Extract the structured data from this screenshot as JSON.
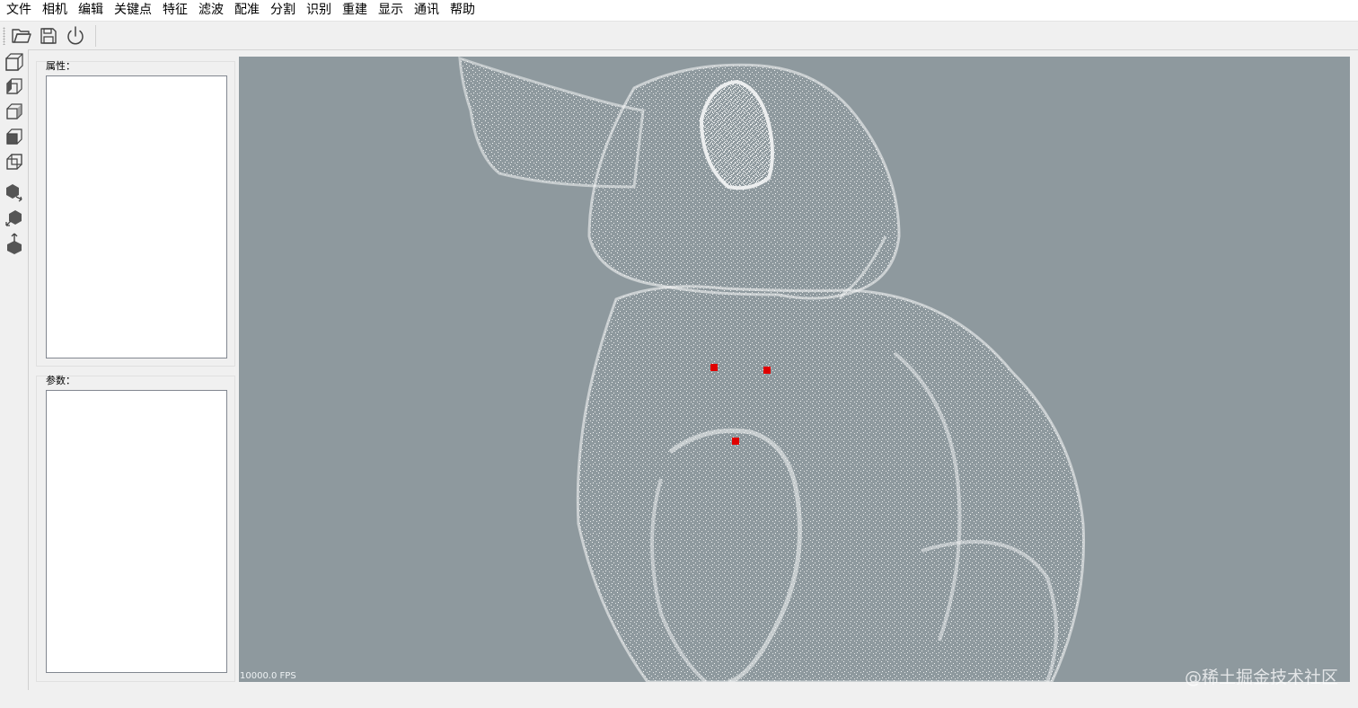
{
  "menu": [
    "文件",
    "相机",
    "编辑",
    "关键点",
    "特征",
    "滤波",
    "配准",
    "分割",
    "识别",
    "重建",
    "显示",
    "通讯",
    "帮助"
  ],
  "toolbar": {
    "icons": [
      "open-folder-icon",
      "save-icon",
      "power-icon"
    ]
  },
  "side_toolbar": {
    "icons": [
      "front-view-cube-icon",
      "left-view-cube-icon",
      "right-view-cube-icon",
      "top-view-cube-icon",
      "back-view-cube-icon",
      "transform-cube-icon",
      "rotate-cube-icon",
      "upload-cube-icon"
    ]
  },
  "properties_panel": {
    "title": "属性："
  },
  "parameters_panel": {
    "title": "参数："
  },
  "viewport": {
    "fps": "10000.0 FPS",
    "background": "#8e999e",
    "point_color": "#ffffff",
    "keypoint_color": "#e00000",
    "keypoint_count": 3
  },
  "watermark": "@稀土掘金技术社区"
}
